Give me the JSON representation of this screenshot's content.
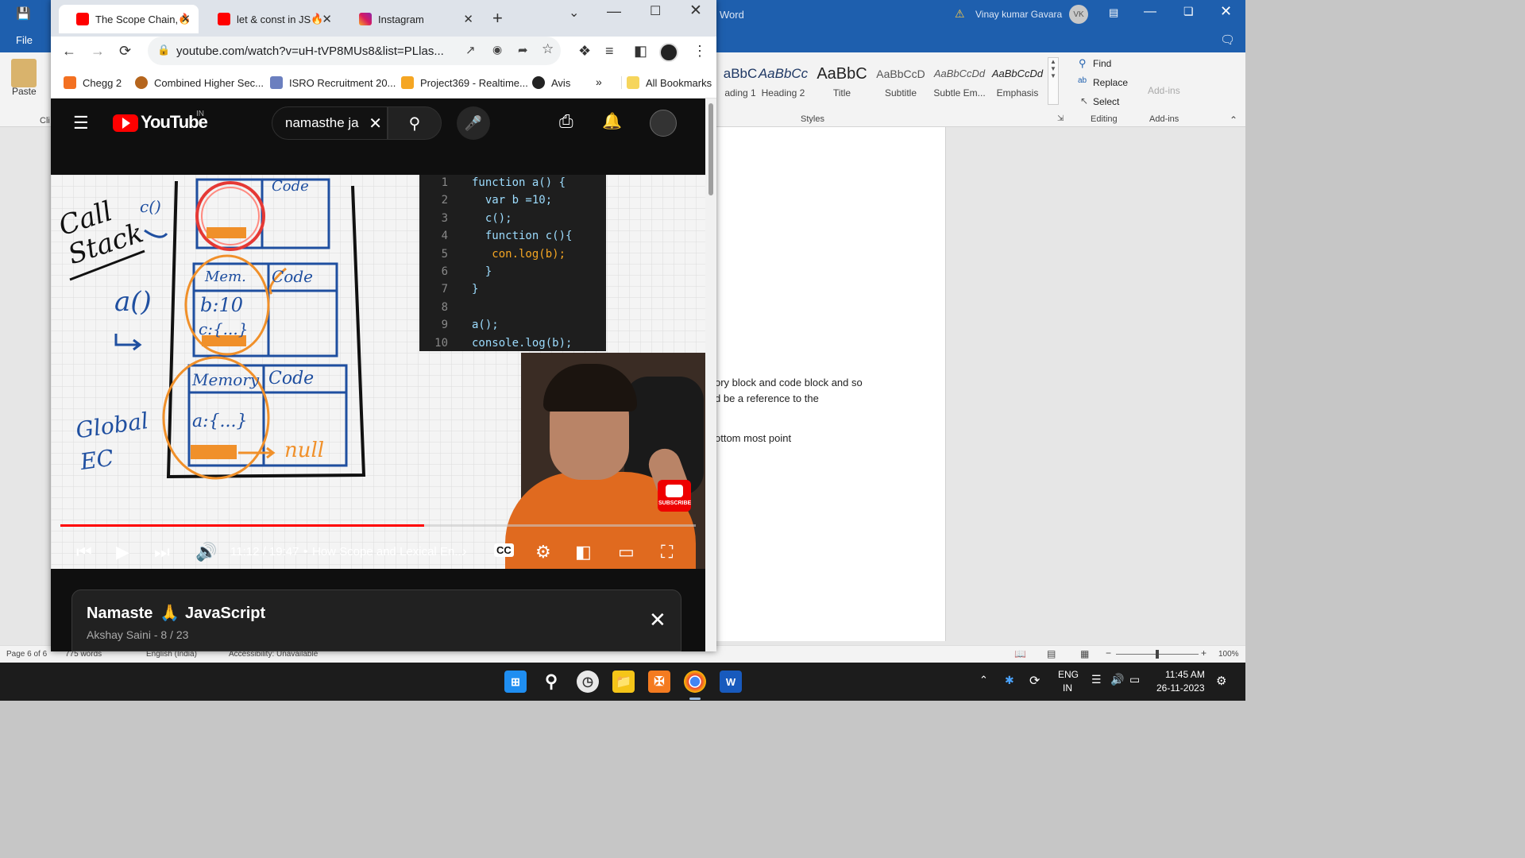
{
  "word": {
    "app_name": "Word",
    "user": "Vinay kumar Gavara",
    "avatar_initials": "VK",
    "file_menu": "File",
    "paste_label": "Paste",
    "styles": [
      {
        "sample": "aBbC",
        "name": "ading 1"
      },
      {
        "sample": "AaBbCc",
        "name": "Heading 2"
      },
      {
        "sample": "AaBbC",
        "name": "Title"
      },
      {
        "sample": "AaBbCcD",
        "name": "Subtitle"
      },
      {
        "sample": "AaBbCcDd",
        "name": "Subtle Em..."
      },
      {
        "sample": "AaBbCcDd",
        "name": "Emphasis"
      }
    ],
    "styles_group": "Styles",
    "editing": {
      "find": "Find",
      "replace": "Replace",
      "select": "Select",
      "group": "Editing"
    },
    "addins": {
      "label": "Add-ins",
      "group": "Add-ins"
    },
    "doc_lines": [
      "ory block and code block and so",
      "d be a reference to the",
      "ottom most point"
    ],
    "status": {
      "page": "Page 6 of 6",
      "words": "775 words",
      "language": "English (India)",
      "accessibility": "Accessibility: Unavailable",
      "zoom": "100%"
    }
  },
  "chrome": {
    "tabs": [
      {
        "title": "The Scope Chain, ",
        "active": true
      },
      {
        "title": "let & const in JS ",
        "active": false
      },
      {
        "title": "Instagram",
        "active": false
      }
    ],
    "url": "youtube.com/watch?v=uH-tVP8MUs8&list=PLlas...",
    "bookmarks": [
      "Chegg 2",
      "Combined Higher Sec...",
      "ISRO Recruitment 20...",
      "Project369 - Realtime...",
      "Avis",
      "All Bookmarks"
    ]
  },
  "youtube": {
    "logo": "YouTube",
    "region": "IN",
    "search_value": "namasthe ja",
    "video": {
      "code_lines": [
        {
          "num": "1",
          "code": "function a() {"
        },
        {
          "num": "2",
          "code": "  var b =10;"
        },
        {
          "num": "3",
          "code": "  c();"
        },
        {
          "num": "4",
          "code": "  function c(){"
        },
        {
          "num": "5",
          "code": "   con.log(b);"
        },
        {
          "num": "6",
          "code": "  }"
        },
        {
          "num": "7",
          "code": "}"
        },
        {
          "num": "8",
          "code": ""
        },
        {
          "num": "9",
          "code": "a();"
        },
        {
          "num": "10",
          "code": "console.log(b);"
        }
      ],
      "whiteboard": {
        "call_stack": "Call Stack",
        "c_call": "c()",
        "a_call": "a()",
        "global": "Global EC",
        "code": "Code",
        "mem": "Mem.",
        "memory": "Memory",
        "b_val": "b:10",
        "c_val": "c:{...}",
        "a_val": "a:{...}",
        "null": "null"
      },
      "subscribe": "SUBSCRIBE",
      "progress": 0.5729
    },
    "time": "11:12 / 19:47",
    "chapter": "How Scope and Lexical En...",
    "playlist": {
      "title_a": "Namaste",
      "title_b": "JavaScript",
      "meta": "Akshay Saini - 8 / 23"
    }
  },
  "taskbar": {
    "lang_a": "ENG",
    "lang_b": "IN",
    "time": "11:45 AM",
    "date": "26-11-2023"
  }
}
